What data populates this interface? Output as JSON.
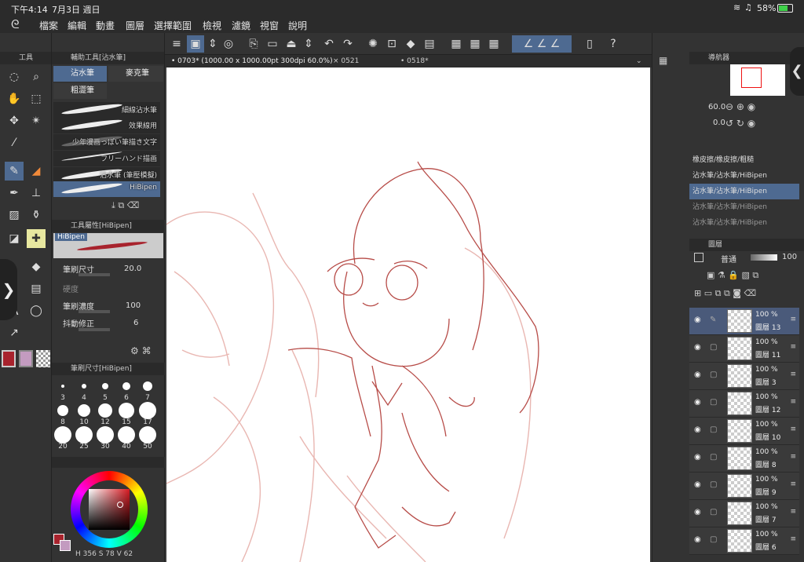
{
  "status": {
    "time": "下午4:14",
    "date": "7月3日 週日",
    "battery": "58%"
  },
  "menu": [
    "檔案",
    "編輯",
    "動畫",
    "圖層",
    "選擇範圍",
    "檢視",
    "濾鏡",
    "視窗",
    "說明"
  ],
  "left_strip": {
    "header": "工具"
  },
  "subtool": {
    "header": "輔助工具[沾水筆]",
    "items": [
      "沾水筆",
      "麥克筆",
      "粗澀筆"
    ]
  },
  "brushes": [
    "細線沾水筆",
    "效果線用",
    "少年漫画っぽい筆描き文字",
    "フリーハンド描画",
    "沾水筆 (筆壓模擬)",
    "HiBipen"
  ],
  "tool_prop": {
    "header": "工具屬性[HiBipen]",
    "brush_name": "HiBipen",
    "rows": [
      {
        "label": "筆刷尺寸",
        "value": "20.0"
      },
      {
        "label": "硬度",
        "value": ""
      },
      {
        "label": "筆刷濃度",
        "value": "100"
      },
      {
        "label": "抖動修正",
        "value": "6"
      }
    ]
  },
  "brush_size": {
    "header": "筆刷尺寸[HiBipen]",
    "sizes": [
      "3",
      "4",
      "5",
      "6",
      "7",
      "8",
      "10",
      "12",
      "15",
      "17",
      "20",
      "25",
      "30",
      "40",
      "50"
    ]
  },
  "color": {
    "readout": "356",
    "s": "78",
    "v": "62",
    "main": "#a8232d",
    "sub": "#c39bc0"
  },
  "tabs": [
    "0703* (1000.00 x 1000.00pt 300dpi 60.0%)",
    "0521",
    "0518*"
  ],
  "navigator": {
    "header": "導航器",
    "zoom": "60.0",
    "rotate": "0.0"
  },
  "presets": [
    "橡皮擦/橡皮擦/粗糙",
    "沾水筆/沾水筆/HiBipen",
    "沾水筆/沾水筆/HiBipen",
    "沾水筆/沾水筆/HiBipen",
    "沾水筆/沾水筆/HiBipen"
  ],
  "layers_panel": {
    "header": "圖層",
    "blend": "普通",
    "opacity": "100"
  },
  "layers": [
    {
      "opacity": "100 %",
      "name": "圖層 13",
      "selected": true
    },
    {
      "opacity": "100 %",
      "name": "圖層 11"
    },
    {
      "opacity": "100 %",
      "name": "圖層 3"
    },
    {
      "opacity": "100 %",
      "name": "圖層 12"
    },
    {
      "opacity": "100 %",
      "name": "圖層 10"
    },
    {
      "opacity": "100 %",
      "name": "圖層 8"
    },
    {
      "opacity": "100 %",
      "name": "圖層 9"
    },
    {
      "opacity": "100 %",
      "name": "圖層 7"
    },
    {
      "opacity": "100 %",
      "name": "圖層 6"
    }
  ]
}
